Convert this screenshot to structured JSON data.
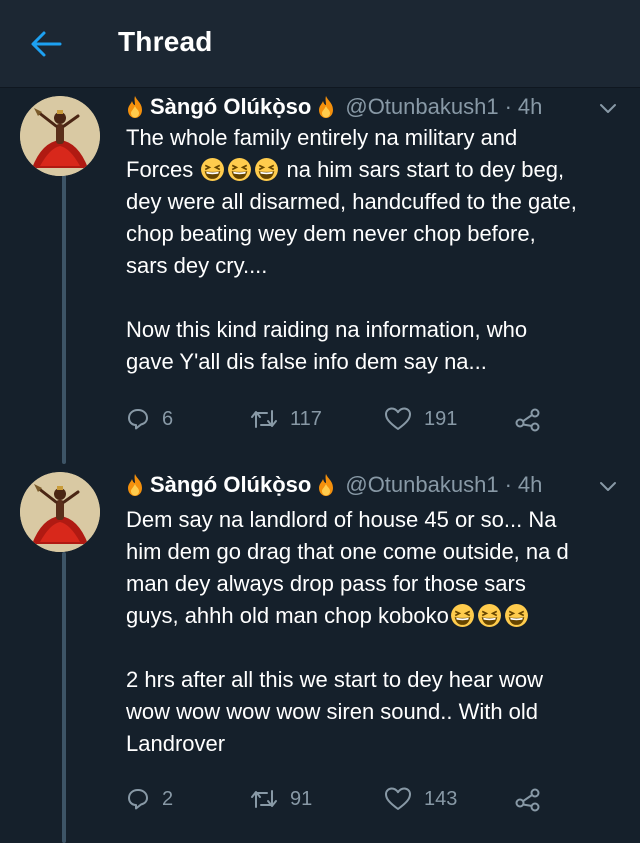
{
  "header": {
    "title": "Thread",
    "back_icon": "arrow-left-icon",
    "accent": "#1da1f2"
  },
  "colors": {
    "background": "#15202b",
    "header_bg": "#1c2733",
    "secondary_text": "#8899a6",
    "thread_line": "#3d5466"
  },
  "tweets": [
    {
      "author": "Sàngó Olúkọ̀so",
      "handle": "@Otunbakush1",
      "dot": "·",
      "time": "4h",
      "body_lines": [
        "The whole family entirely na military and",
        "Forces",
        "na him sars start to dey beg,",
        "dey were all disarmed, handcuffed to the gate,",
        "chop beating wey dem never chop before,",
        "sars dey cry....",
        "Now this kind raiding na information, who",
        "gave Y'all dis false info dem say na..."
      ],
      "emojis": [
        "grinning-squinting-face",
        "grinning-squinting-face",
        "grinning-squinting-face"
      ],
      "replies": "6",
      "retweets": "117",
      "likes": "191"
    },
    {
      "author": "Sàngó Olúkọ̀so",
      "handle": "@Otunbakush1",
      "dot": "·",
      "time": "4h",
      "body_lines": [
        "Dem say na landlord of house 45 or so... Na",
        "him dem go drag that one come outside, na d",
        "man dey always drop pass for those sars",
        "guys, ahhh old man chop koboko",
        "2 hrs after all this we start to dey hear wow",
        "wow wow wow wow siren sound.. With old",
        "Landrover"
      ],
      "emojis": [
        "grinning-squinting-face",
        "grinning-squinting-face",
        "grinning-squinting-face"
      ],
      "replies": "2",
      "retweets": "91",
      "likes": "143"
    }
  ]
}
